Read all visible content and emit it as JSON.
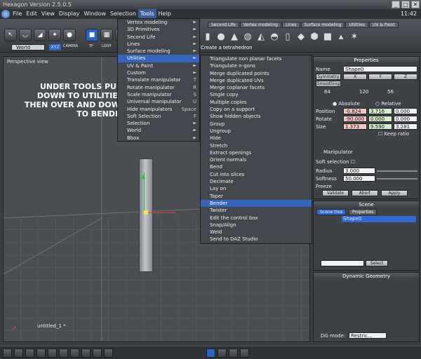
{
  "titlebar": {
    "title": "Hexagon Version 2.5.0.5"
  },
  "window_controls": [
    "_",
    "□",
    "✕"
  ],
  "menubar": {
    "items": [
      "File",
      "Edit",
      "View",
      "Display",
      "Window",
      "Selection",
      "Tools",
      "Help"
    ],
    "active": "Tools",
    "clock": "11:42"
  },
  "toolbar": {
    "world_select": "World",
    "xyz_label": "XYZ",
    "camera_label": "CAMERA",
    "tf_label": "TF",
    "loop_label": "LOOP",
    "status": "Create a tetrahedron"
  },
  "tabs": [
    "Second Life",
    "Vertex modeling",
    "Lines",
    "Surface modeling",
    "Utilities",
    "UV & Paint"
  ],
  "tools_menu": [
    {
      "label": "Vertex modeling",
      "arrow": "►"
    },
    {
      "label": "3D Primitives",
      "arrow": "►"
    },
    {
      "label": "Second Life",
      "arrow": "►"
    },
    {
      "label": "Lines",
      "arrow": "►"
    },
    {
      "label": "Surface modeling",
      "arrow": "►"
    },
    {
      "label": "Utilities",
      "arrow": "►"
    },
    {
      "label": "UV & Paint",
      "arrow": "►"
    },
    {
      "label": "Custom",
      "arrow": "►"
    },
    {
      "label": "Translate manipulator",
      "shortcut": "T"
    },
    {
      "label": "Rotate manipulator",
      "shortcut": "R"
    },
    {
      "label": "Scale manipulator",
      "shortcut": "S"
    },
    {
      "label": "Universal manipulator",
      "shortcut": "U"
    },
    {
      "label": "Hide manipulators",
      "shortcut": "Space"
    },
    {
      "label": "Soft Selection",
      "shortcut": "F"
    },
    {
      "label": "Selection",
      "arrow": "►"
    },
    {
      "label": "World",
      "arrow": "►"
    },
    {
      "label": "Bbox",
      "arrow": "►"
    }
  ],
  "utilities_menu": [
    "Triangulate non planar facets",
    "Triangulate n-gons",
    "Merge duplicated points",
    "Merge duplicated UVs",
    "Merge coplanar facets",
    "Single copy",
    "Multiple copies",
    "Copy on a support",
    "Show hidden objects",
    "Group",
    "Ungroup",
    "Hide",
    "Stretch",
    "Extract openings",
    "Orient normals",
    "Bend",
    "Cut into slices",
    "Decimate",
    "Lay on",
    "Taper",
    "Bender",
    "Twister",
    "Edit the control box",
    "Snap/Align",
    "Weld",
    "Send to DAZ Studio"
  ],
  "viewport": {
    "label": "Perspective view",
    "annotation": "UNDER TOOLS PULL DOWN TO UTILITIES, THEN OVER AND DOWN TO BENDER",
    "footer": "untitled_1 *"
  },
  "properties": {
    "title": "Properties",
    "name_label": "Name",
    "name_value": "Shape0",
    "symmetry_label": "Symmetry",
    "axes": [
      "X",
      "Y",
      "Z"
    ],
    "smoothing_label": "Smoothing",
    "smooth_values": [
      "64",
      "120",
      "56"
    ],
    "position_label": "Position",
    "position": [
      "-0.824",
      "3.716",
      "0.000"
    ],
    "rotate_label": "Rotate",
    "rotate": [
      "-90.000",
      "0.000",
      "0.000"
    ],
    "size_label": "Size",
    "size": [
      "1.373",
      "9.590",
      "3.281"
    ],
    "absolute_label": "Absolute",
    "relative_label": "Relative",
    "keep_ratio": "Keep ratio",
    "manipulator_label": "Manipulator",
    "soft_label": "Soft selection",
    "radius_label": "Radius",
    "radius_value": "3.000",
    "softness_label": "Softness",
    "softness_value": "50.000",
    "freeze_label": "Freeze",
    "validate": "Validate",
    "abort": "Abort",
    "apply": "Apply"
  },
  "scene": {
    "title": "Scene",
    "tab1": "Scene tree",
    "tab2": "Properties",
    "item": "Shape0",
    "select_btn": "Select"
  },
  "dyngeo": {
    "title": "Dynamic Geometry",
    "mode_label": "DG mode:",
    "mode_value": "Restric..."
  }
}
